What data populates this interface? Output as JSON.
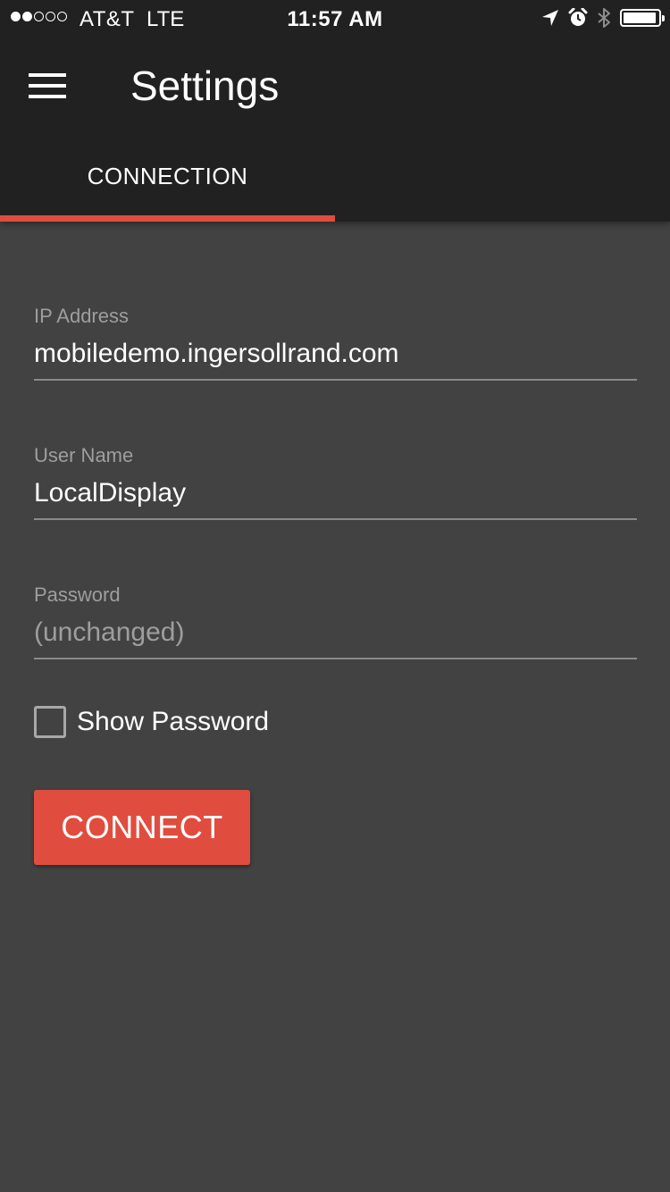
{
  "status_bar": {
    "signal_bars_filled": 2,
    "signal_bars_total": 5,
    "carrier": "AT&T",
    "network": "LTE",
    "time": "11:57 AM",
    "icons": [
      "location-arrow-icon",
      "alarm-clock-icon",
      "bluetooth-icon",
      "battery-icon"
    ],
    "battery_level": 0.95
  },
  "toolbar": {
    "menu_icon": "hamburger-menu-icon",
    "title": "Settings"
  },
  "tabs": [
    {
      "label": "CONNECTION",
      "active": true
    }
  ],
  "form": {
    "ip_address": {
      "label": "IP Address",
      "value": "mobiledemo.ingersollrand.com",
      "placeholder": ""
    },
    "user_name": {
      "label": "User Name",
      "value": "LocalDisplay",
      "placeholder": ""
    },
    "password": {
      "label": "Password",
      "value": "",
      "placeholder": "(unchanged)"
    },
    "show_password": {
      "label": "Show Password",
      "checked": false
    },
    "connect_label": "CONNECT"
  },
  "colors": {
    "header_bg": "#212121",
    "page_bg": "#424242",
    "accent": "#e04d3e",
    "button_bg": "#e04d3e",
    "label": "#9e9e9e",
    "text": "#ffffff"
  }
}
